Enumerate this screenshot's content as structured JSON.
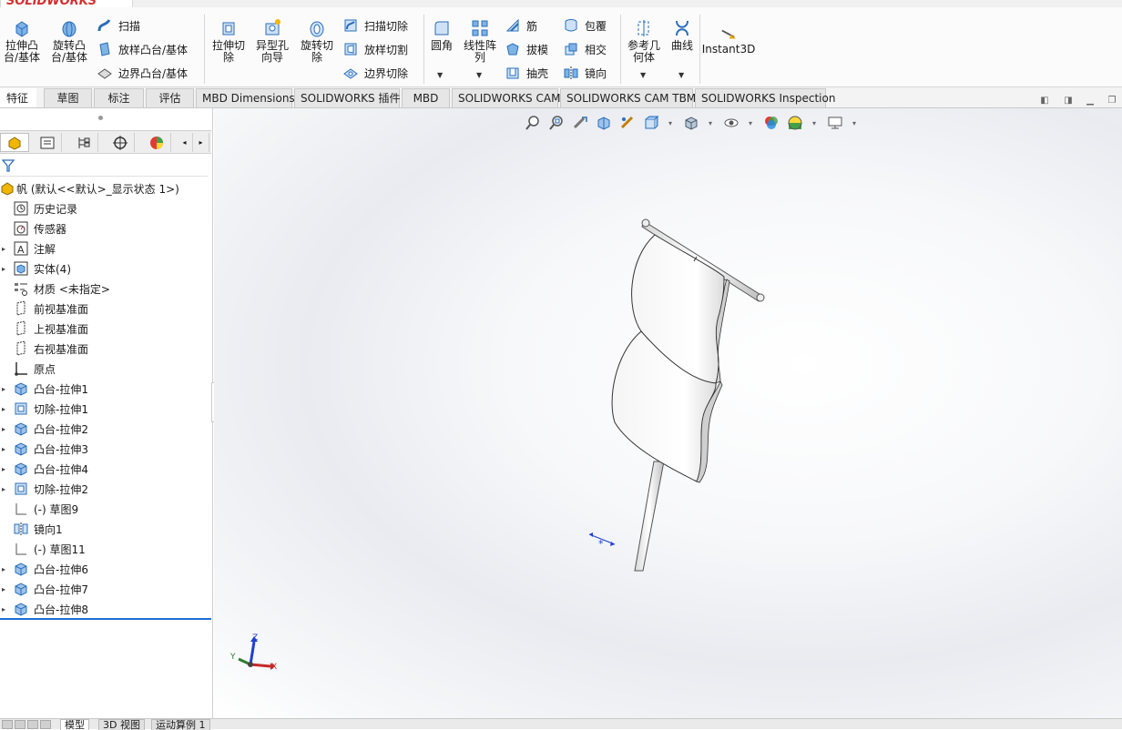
{
  "app": {
    "logo": "SOLIDWORKS"
  },
  "ribbon": {
    "extrude_boss": "拉伸凸\n台/基体",
    "revolve_boss": "旋转凸\n台/基体",
    "sweep": "扫描",
    "loft_boss": "放样凸台/基体",
    "boundary_boss": "边界凸台/基体",
    "extrude_cut": "拉伸切\n除",
    "hole_wizard": "异型孔\n向导",
    "revolve_cut": "旋转切\n除",
    "sweep_cut": "扫描切除",
    "loft_cut": "放样切割",
    "boundary_cut": "边界切除",
    "fillet": "圆角",
    "linear_pattern": "线性阵\n列",
    "rib": "筋",
    "draft": "拔模",
    "shell": "抽壳",
    "wrap": "包覆",
    "intersect": "相交",
    "mirror": "镜向",
    "ref_geometry": "参考几\n何体",
    "curves": "曲线",
    "instant3d": "Instant3D"
  },
  "tabs": [
    {
      "label": "特征",
      "active": true
    },
    {
      "label": "草图"
    },
    {
      "label": "标注"
    },
    {
      "label": "评估"
    },
    {
      "label": "MBD Dimensions"
    },
    {
      "label": "SOLIDWORKS 插件"
    },
    {
      "label": "MBD"
    },
    {
      "label": "SOLIDWORKS CAM"
    },
    {
      "label": "SOLIDWORKS CAM TBM"
    },
    {
      "label": "SOLIDWORKS Inspection"
    }
  ],
  "tree": {
    "root": "帆  (默认<<默认>_显示状态 1>)",
    "items": [
      {
        "label": "历史记录",
        "icon": "history-icon",
        "expandable": false
      },
      {
        "label": "传感器",
        "icon": "sensor-icon",
        "expandable": false
      },
      {
        "label": "注解",
        "icon": "annotation-icon",
        "expandable": true
      },
      {
        "label": "实体(4)",
        "icon": "solid-bodies-icon",
        "expandable": true
      },
      {
        "label": "材质 <未指定>",
        "icon": "material-icon",
        "expandable": false
      },
      {
        "label": "前视基准面",
        "icon": "plane-icon",
        "expandable": false
      },
      {
        "label": "上视基准面",
        "icon": "plane-icon",
        "expandable": false
      },
      {
        "label": "右视基准面",
        "icon": "plane-icon",
        "expandable": false
      },
      {
        "label": "原点",
        "icon": "origin-icon",
        "expandable": false
      },
      {
        "label": "凸台-拉伸1",
        "icon": "boss-extrude-icon",
        "expandable": true
      },
      {
        "label": "切除-拉伸1",
        "icon": "cut-extrude-icon",
        "expandable": true
      },
      {
        "label": "凸台-拉伸2",
        "icon": "boss-extrude-icon",
        "expandable": true
      },
      {
        "label": "凸台-拉伸3",
        "icon": "boss-extrude-icon",
        "expandable": true
      },
      {
        "label": "凸台-拉伸4",
        "icon": "boss-extrude-icon",
        "expandable": true
      },
      {
        "label": "切除-拉伸2",
        "icon": "cut-extrude-icon",
        "expandable": true
      },
      {
        "label": "(-) 草图9",
        "icon": "sketch-icon",
        "expandable": false
      },
      {
        "label": "镜向1",
        "icon": "mirror-icon",
        "expandable": false
      },
      {
        "label": "(-) 草图11",
        "icon": "sketch-icon",
        "expandable": false
      },
      {
        "label": "凸台-拉伸6",
        "icon": "boss-extrude-icon",
        "expandable": true
      },
      {
        "label": "凸台-拉伸7",
        "icon": "boss-extrude-icon",
        "expandable": true
      },
      {
        "label": "凸台-拉伸8",
        "icon": "boss-extrude-icon",
        "expandable": true
      }
    ]
  },
  "triad": {
    "x": "X",
    "y": "Y",
    "z": "Z"
  },
  "bottom_tabs": [
    {
      "label": "模型",
      "active": true
    },
    {
      "label": "3D 视图"
    },
    {
      "label": "运动算例 1"
    }
  ],
  "colors": {
    "accent": "#1f6fd1",
    "icon_blue": "#2a6ebb",
    "logo_red": "#d32f2f"
  }
}
